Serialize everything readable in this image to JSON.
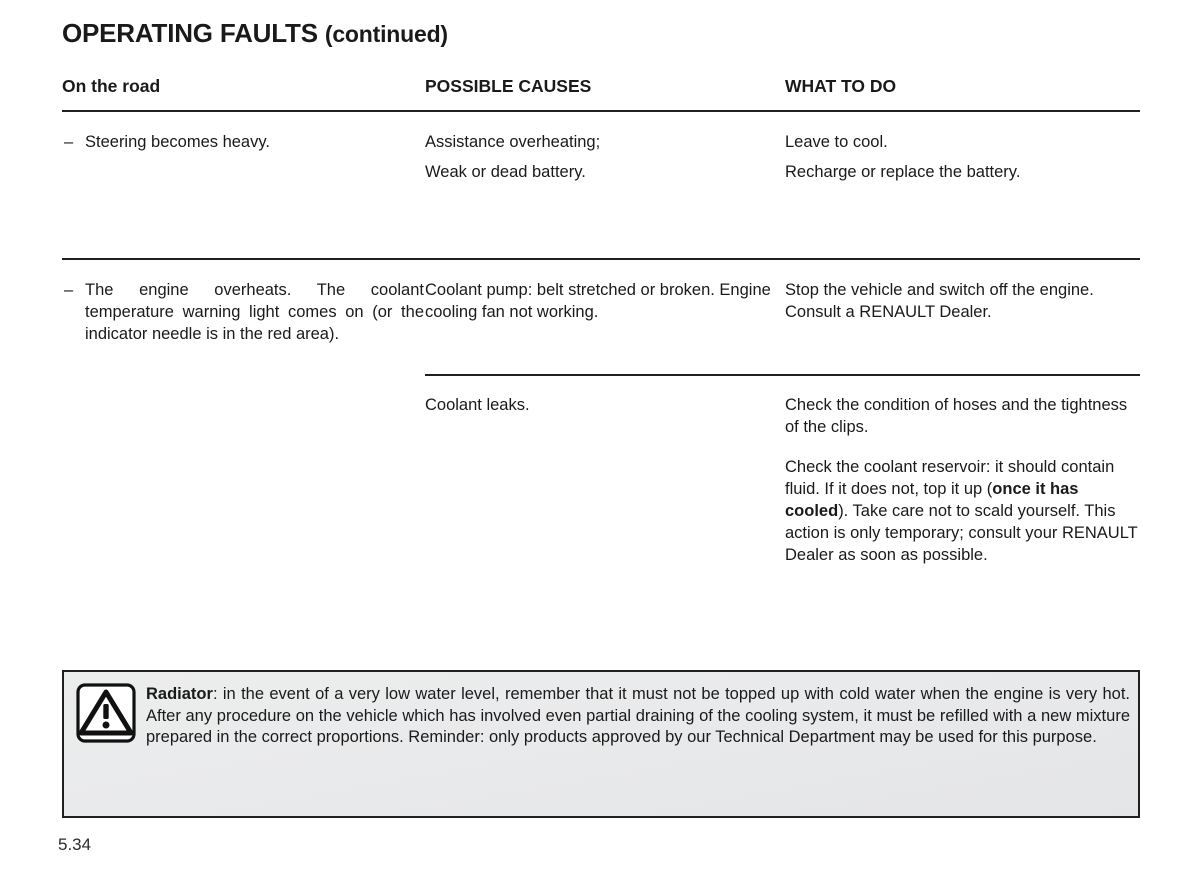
{
  "document": {
    "title_main": "OPERATING FAULTS",
    "title_suffix": "(continued)",
    "page_number": "5.34"
  },
  "table": {
    "headers": {
      "col1": "On the road",
      "col2": "POSSIBLE CAUSES",
      "col3": "WHAT TO DO"
    },
    "rows": [
      {
        "symptom": "Steering becomes heavy.",
        "causes": [
          "Assistance overheating;",
          "Weak or dead battery."
        ],
        "actions": [
          "Leave to cool.",
          "Recharge or replace the battery."
        ]
      },
      {
        "symptom": "The engine overheats. The coolant temperature warning light comes on (or the indicator needle is in the red area).",
        "causes": [
          "Coolant pump: belt stretched or broken. Engine cooling fan not working."
        ],
        "actions": [
          "Stop the vehicle and switch off the engine. Consult a RENAULT Dealer."
        ]
      },
      {
        "symptom": "",
        "causes": [
          "Coolant leaks."
        ],
        "actions_part1": "Check the condition of hoses and the tightness of the clips.",
        "actions_part2_a": "Check the coolant reservoir: it should contain fluid. If it does not, top it up (",
        "actions_part2_bold": "once it has cooled",
        "actions_part2_b": "). Take care not to scald yourself. This action is only temporary; consult your RENAULT Dealer as soon as possible."
      }
    ]
  },
  "warning": {
    "icon": "warning-triangle-icon",
    "lead": "Radiator",
    "body": ": in the event of a very low water level, remember that it must not be topped up with cold water when the engine is very hot. After any procedure on the vehicle which has involved even partial draining of the cooling system, it must be refilled with a new mixture prepared in the correct proportions. Reminder: only products approved by our Technical Department may be used for this purpose."
  },
  "colors": {
    "text": "#1a1a1a",
    "rule": "#231f20",
    "warning_background": "#e9eaeb"
  }
}
